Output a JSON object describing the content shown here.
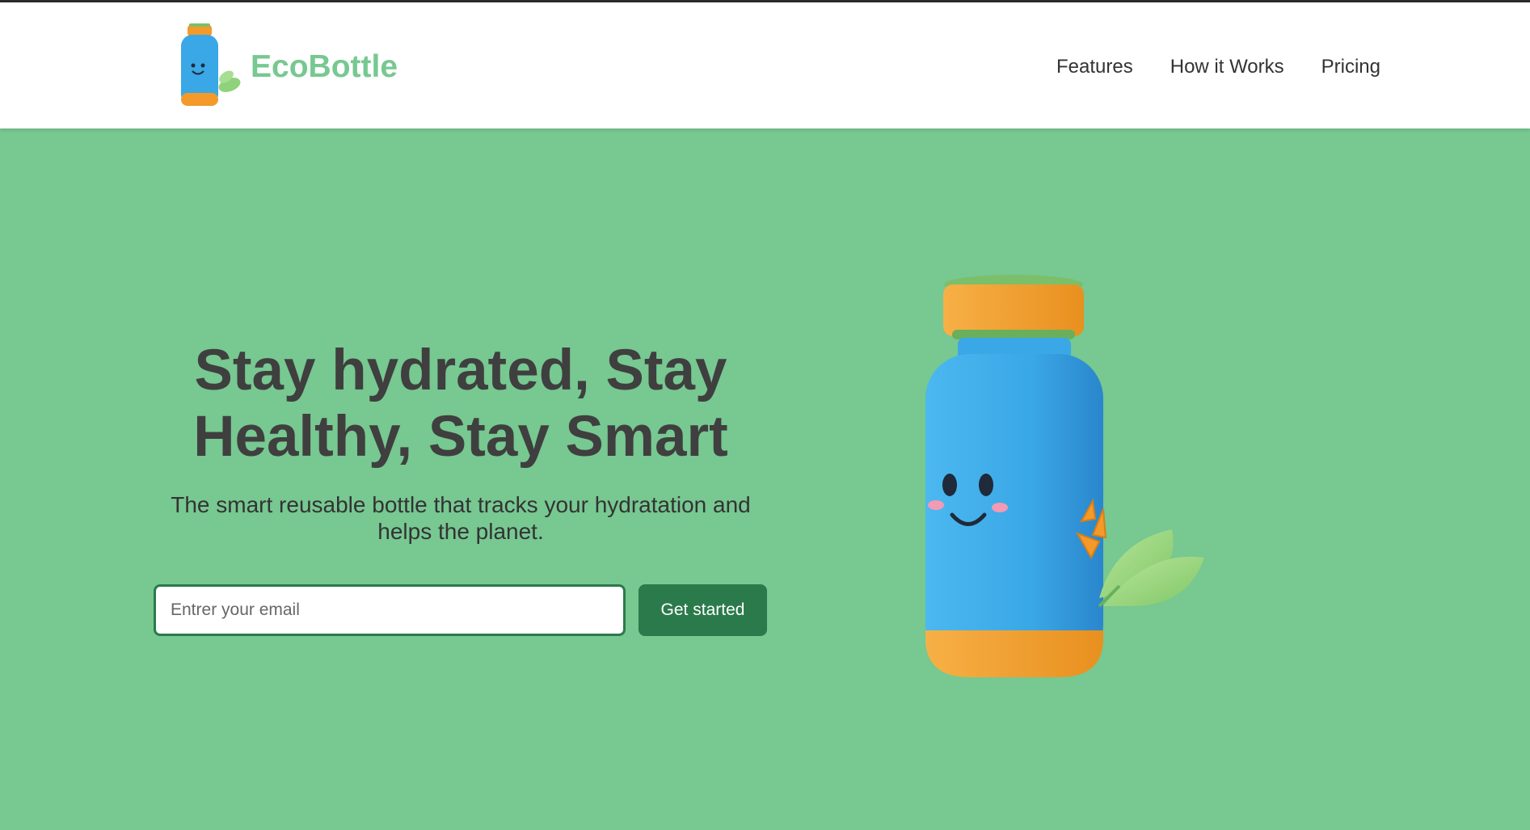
{
  "brand": {
    "name": "EcoBottle",
    "logo_icon": "bottle-mascot-icon"
  },
  "nav": {
    "links": [
      {
        "label": "Features"
      },
      {
        "label": "How it Works"
      },
      {
        "label": "Pricing"
      }
    ]
  },
  "hero": {
    "title": "Stay hydrated, Stay Healthy, Stay Smart",
    "subtitle": "The smart reusable bottle that tracks your hydratation and helps the planet.",
    "email_placeholder": "Entrer your email",
    "email_value": "",
    "cta_label": "Get started",
    "image_icon": "bottle-mascot-illustration"
  },
  "colors": {
    "brand_green": "#77c891",
    "dark_green": "#2b7a4b",
    "bottle_blue": "#3aa7e6",
    "bottle_orange": "#f39a2b",
    "heading_text": "#3f3f3f"
  }
}
